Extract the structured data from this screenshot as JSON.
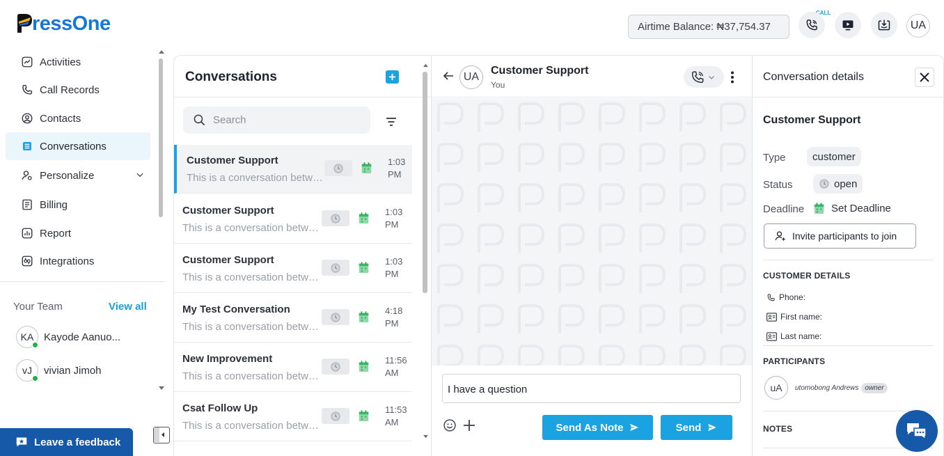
{
  "header": {
    "logo_text": "ressOne",
    "airtime": "Airtime Balance: ₦37,754.37",
    "call_tag": "CALL",
    "user_initials": "UA"
  },
  "sidebar": {
    "items": [
      {
        "label": "Activities"
      },
      {
        "label": "Call Records"
      },
      {
        "label": "Contacts"
      },
      {
        "label": "Conversations"
      },
      {
        "label": "Personalize"
      },
      {
        "label": "Billing"
      },
      {
        "label": "Report"
      },
      {
        "label": "Integrations"
      }
    ],
    "team_title": "Your Team",
    "view_all": "View all",
    "members": [
      {
        "initials": "KA",
        "name": "Kayode Aanuo..."
      },
      {
        "initials": "vJ",
        "name": "vivian Jimoh"
      }
    ],
    "feedback": "Leave a feedback"
  },
  "conversations": {
    "title": "Conversations",
    "search_placeholder": "Search",
    "rows": [
      {
        "name": "Customer Support",
        "preview": "This is a conversation between...",
        "time1": "1:03",
        "time2": "PM"
      },
      {
        "name": "Customer Support",
        "preview": "This is a conversation between...",
        "time1": "1:03",
        "time2": "PM"
      },
      {
        "name": "Customer Support",
        "preview": "This is a conversation between...",
        "time1": "1:03",
        "time2": "PM"
      },
      {
        "name": "My Test Conversation",
        "preview": "This is a conversation between...",
        "time1": "4:18",
        "time2": "PM"
      },
      {
        "name": "New Improvement",
        "preview": "This is a conversation between...",
        "time1": "11:56",
        "time2": "AM"
      },
      {
        "name": "Csat Follow Up",
        "preview": "This is a conversation between...",
        "time1": "11:53",
        "time2": "AM"
      }
    ]
  },
  "chat": {
    "avatar": "UA",
    "name": "Customer Support",
    "sub": "You",
    "message": "I have a question",
    "send_note": "Send As Note",
    "send": "Send"
  },
  "details": {
    "title": "Conversation details",
    "name": "Customer Support",
    "type_label": "Type",
    "type_value": "customer",
    "status_label": "Status",
    "status_value": "open",
    "deadline_label": "Deadline",
    "deadline_value": "Set Deadline",
    "invite": "Invite participants to join",
    "customer_details": "CUSTOMER DETAILS",
    "phone": "Phone:",
    "first_name": "First name:",
    "last_name": "Last name:",
    "participants": "PARTICIPANTS",
    "participant_initials": "uA",
    "participant_name": "utomobong Andrews",
    "participant_role": "owner",
    "notes": "NOTES"
  },
  "colors": {
    "accent": "#1aa3e0",
    "brand": "#1677d6",
    "feedback_bg": "#1659a8"
  }
}
